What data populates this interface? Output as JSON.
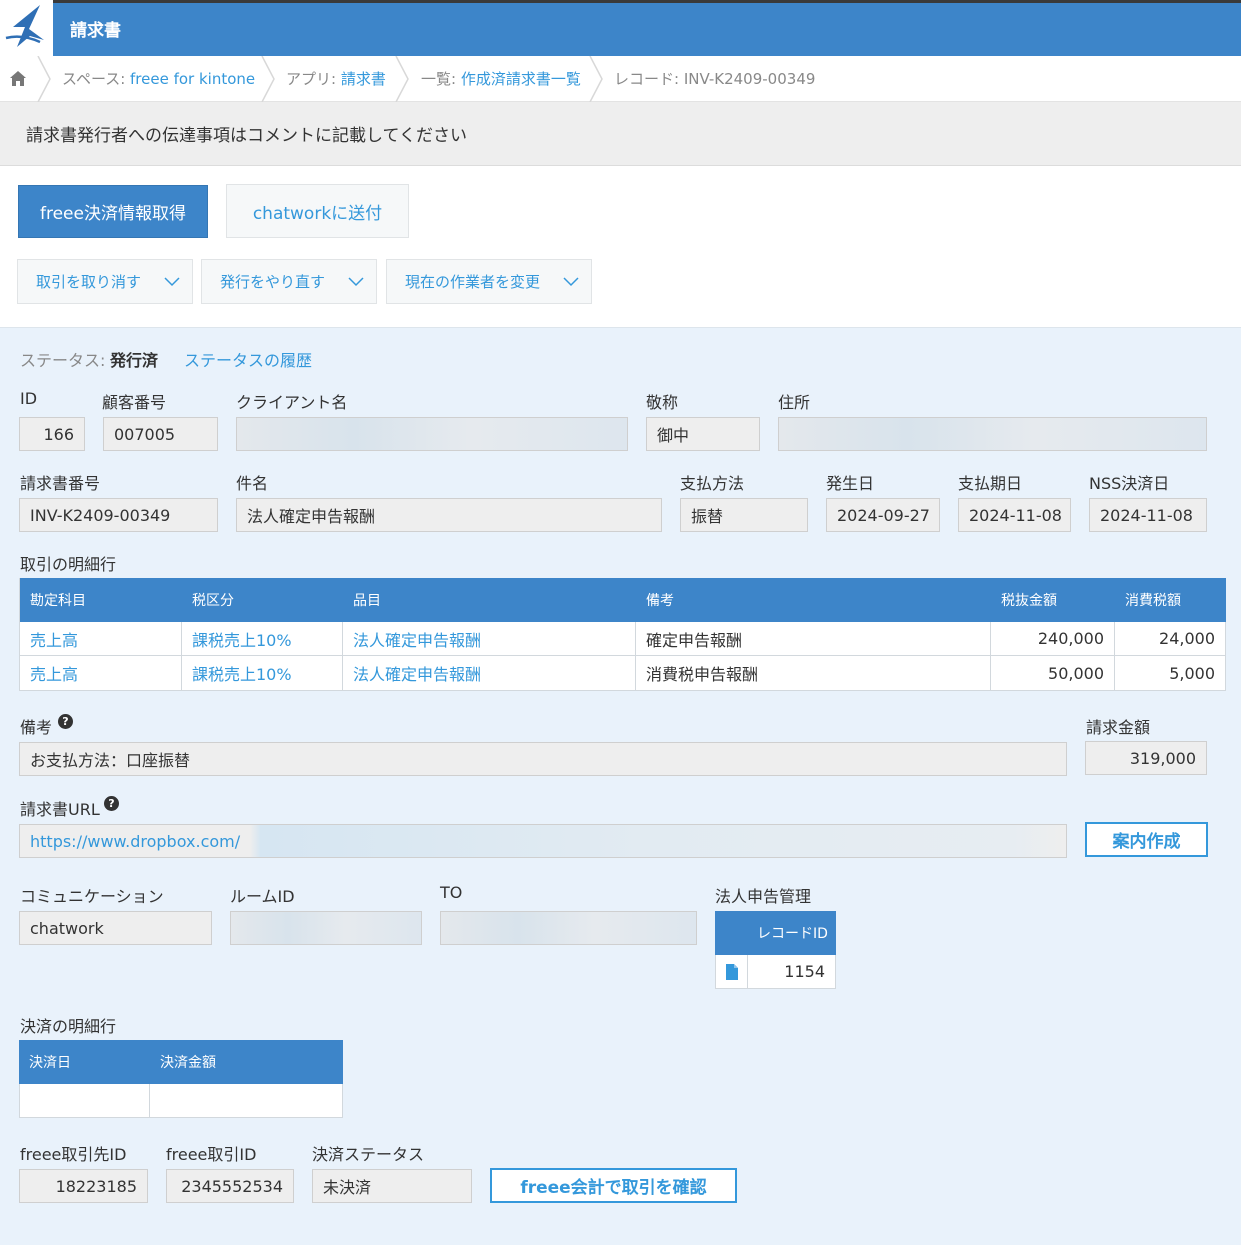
{
  "header": {
    "app_title": "請求書"
  },
  "breadcrumb": {
    "space_prefix": "スペース: ",
    "space_name": "freee for kintone",
    "app_prefix": "アプリ: ",
    "app_name": "請求書",
    "list_prefix": "一覧: ",
    "list_name": "作成済請求書一覧",
    "record_label": "レコード: INV-K2409-00349"
  },
  "notice": "請求書発行者への伝達事項はコメントに記載してください",
  "actions": {
    "primary": "freee決済情報取得",
    "secondary": "chatworkに送付",
    "dropdowns": [
      "取引を取り消す",
      "発行をやり直す",
      "現在の作業者を変更"
    ]
  },
  "status": {
    "label": "ステータス: ",
    "value": "発行済",
    "history_link": "ステータスの履歴"
  },
  "row1": {
    "id_label": "ID",
    "id": "166",
    "customer_no_label": "顧客番号",
    "customer_no": "007005",
    "client_label": "クライアント名",
    "honorific_label": "敬称",
    "honorific": "御中",
    "address_label": "住所"
  },
  "row2": {
    "invoice_no_label": "請求書番号",
    "invoice_no": "INV-K2409-00349",
    "subject_label": "件名",
    "subject": "法人確定申告報酬",
    "payment_method_label": "支払方法",
    "payment_method": "振替",
    "issue_date_label": "発生日",
    "issue_date": "2024-09-27",
    "due_date_label": "支払期日",
    "due_date": "2024-11-08",
    "nss_date_label": "NSS決済日",
    "nss_date": "2024-11-08"
  },
  "details": {
    "title": "取引の明細行",
    "headers": [
      "勘定科目",
      "税区分",
      "品目",
      "備考",
      "税抜金額",
      "消費税額"
    ],
    "rows": [
      [
        "売上高",
        "課税売上10%",
        "法人確定申告報酬",
        "確定申告報酬",
        "240,000",
        "24,000"
      ],
      [
        "売上高",
        "課税売上10%",
        "法人確定申告報酬",
        "消費税申告報酬",
        "50,000",
        "5,000"
      ]
    ]
  },
  "remarks": {
    "label": "備考",
    "value": "お支払方法：口座振替",
    "help": "?"
  },
  "amount": {
    "label": "請求金額",
    "value": "319,000"
  },
  "invoice_url": {
    "label": "請求書URL",
    "value": "https://www.dropbox.com/",
    "help": "?",
    "button": "案内作成"
  },
  "communication": {
    "comm_label": "コミュニケーション",
    "comm": "chatwork",
    "room_label": "ルームID",
    "to_label": "TO",
    "corp_label": "法人申告管理",
    "record_id_header": "レコードID",
    "record_id": "1154"
  },
  "settlement": {
    "title": "決済の明細行",
    "headers": [
      "決済日",
      "決済金額"
    ]
  },
  "freee": {
    "partner_id_label": "freee取引先ID",
    "partner_id": "18223185",
    "deal_id_label": "freee取引ID",
    "deal_id": "2345552534",
    "status_label": "決済ステータス",
    "status": "未決済",
    "button": "freee会計で取引を確認"
  }
}
